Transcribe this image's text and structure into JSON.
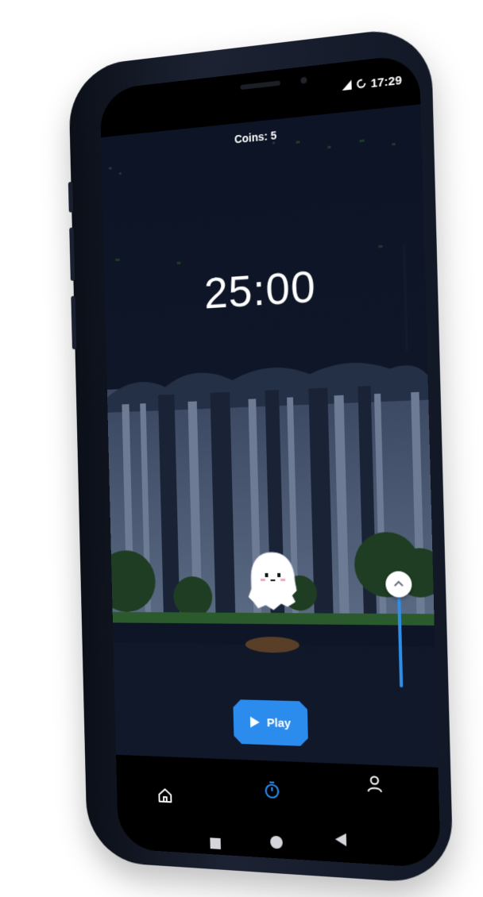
{
  "status_bar": {
    "time": "17:29"
  },
  "game": {
    "coins_label": "Coins: 5",
    "timer": "25:00",
    "play_label": "Play"
  },
  "nav": {
    "items": [
      {
        "icon": "home-icon"
      },
      {
        "icon": "stopwatch-icon",
        "active": true
      },
      {
        "icon": "profile-icon"
      }
    ],
    "active_color": "#2c8cee"
  },
  "system_nav": {
    "items": [
      {
        "icon": "recents-square-icon"
      },
      {
        "icon": "home-circle-icon"
      },
      {
        "icon": "back-triangle-icon"
      }
    ]
  },
  "colors": {
    "accent": "#2c8cee",
    "background": "#0c1426"
  }
}
